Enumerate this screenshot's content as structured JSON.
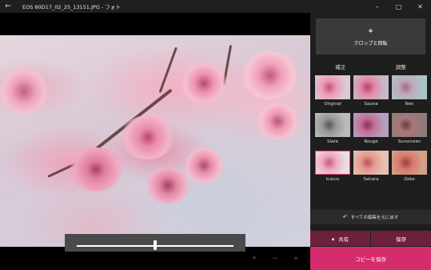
{
  "titlebar": {
    "back_icon": "back-arrow-icon",
    "title": "EOS 80D17_02_25_13151.JPG - フォト",
    "minimize_icon": "minimize-icon",
    "maximize_icon": "maximize-icon",
    "close_icon": "close-icon"
  },
  "editor": {
    "crop_rotate_label": "クロップと回転",
    "tabs": [
      {
        "label": "補正",
        "selected": false
      },
      {
        "label": "調整",
        "selected": true
      }
    ],
    "filters": [
      {
        "name": "Original",
        "selected": false
      },
      {
        "name": "Sauna",
        "selected": false
      },
      {
        "name": "Neo",
        "selected": false
      },
      {
        "name": "Slate",
        "selected": false
      },
      {
        "name": "Rouge",
        "selected": false
      },
      {
        "name": "Sunscreen",
        "selected": false
      },
      {
        "name": "Icarus",
        "selected": true
      },
      {
        "name": "Sahara",
        "selected": false
      },
      {
        "name": "Zeke",
        "selected": false
      }
    ],
    "undo_all_label": "すべての編集を元に戻す",
    "share_label": "共有",
    "save_label": "保存",
    "save_copy_label": "コピーを保存"
  },
  "image_toolbar": {
    "icons": [
      "crop-frame-icon",
      "zoom-out-icon",
      "zoom-in-icon"
    ]
  },
  "intensity_slider": {
    "value_fraction": 0.5
  },
  "colors": {
    "accent": "#d42c6c",
    "accent_dark": "#6d1f3e",
    "panel_bg": "#1e1e1e",
    "selected_outline": "#e0407b"
  }
}
